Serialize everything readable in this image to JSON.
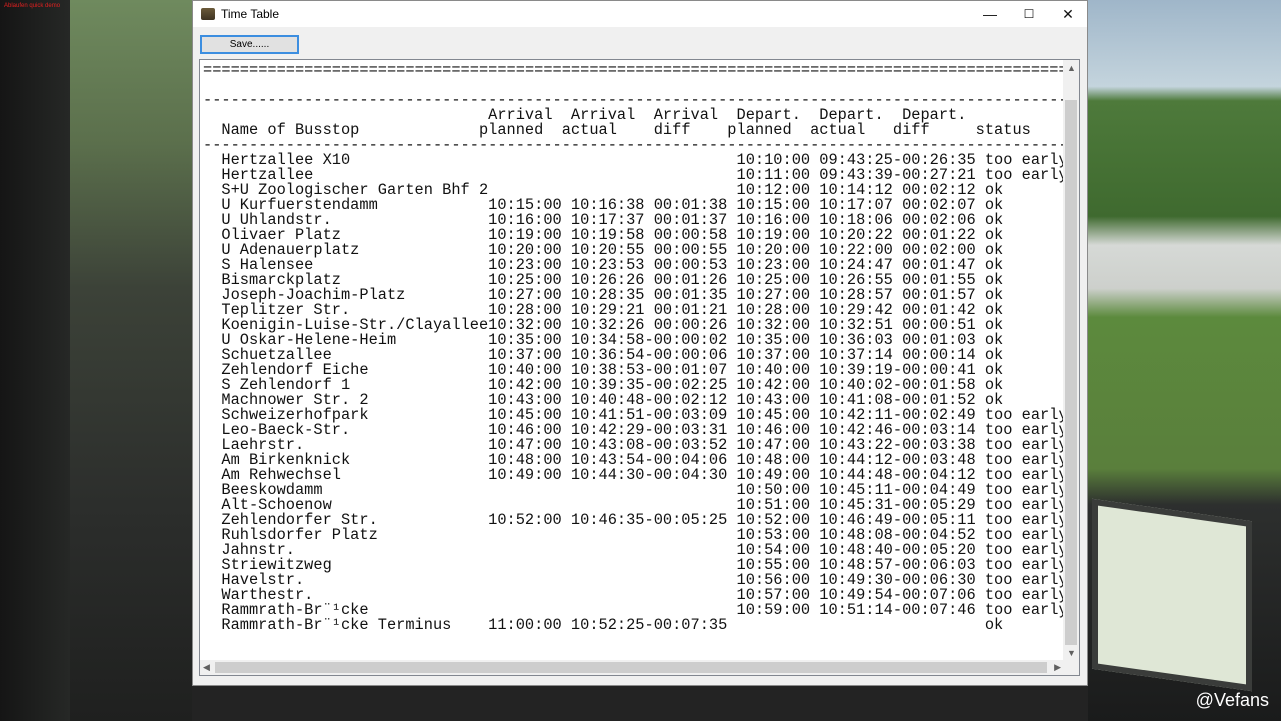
{
  "window": {
    "title": "Time Table",
    "save_label": "Save......",
    "minimize": "—",
    "maximize": "☐",
    "close": "✕"
  },
  "overlay": {
    "watermark": "@Vefans",
    "corner_text": "Ablaufen quick demo"
  },
  "separators": {
    "double": "==========================================================================================================",
    "single": "----------------------------------------------------------------------------------------------------------"
  },
  "header": {
    "name": "Name of Busstop",
    "arr_planned": [
      "Arrival",
      "planned"
    ],
    "arr_actual": [
      "Arrival",
      "actual"
    ],
    "arr_diff": [
      "Arrival",
      "diff"
    ],
    "dep_planned": [
      "Depart.",
      "planned"
    ],
    "dep_actual": [
      "Depart.",
      "actual"
    ],
    "dep_diff": [
      "Depart.",
      "diff"
    ],
    "status": "status"
  },
  "rows": [
    [
      "Hertzallee X10",
      "",
      "",
      "",
      "10:10:00",
      "09:43:25",
      "-00:26:35",
      "too early"
    ],
    [
      "Hertzallee",
      "",
      "",
      "",
      "10:11:00",
      "09:43:39",
      "-00:27:21",
      "too early"
    ],
    [
      "S+U Zoologischer Garten Bhf 2",
      "",
      "",
      "",
      "10:12:00",
      "10:14:12",
      "00:02:12",
      "ok"
    ],
    [
      "U Kurfuerstendamm",
      "10:15:00",
      "10:16:38",
      "00:01:38",
      "10:15:00",
      "10:17:07",
      "00:02:07",
      "ok"
    ],
    [
      "U Uhlandstr.",
      "10:16:00",
      "10:17:37",
      "00:01:37",
      "10:16:00",
      "10:18:06",
      "00:02:06",
      "ok"
    ],
    [
      "Olivaer Platz",
      "10:19:00",
      "10:19:58",
      "00:00:58",
      "10:19:00",
      "10:20:22",
      "00:01:22",
      "ok"
    ],
    [
      "U Adenauerplatz",
      "10:20:00",
      "10:20:55",
      "00:00:55",
      "10:20:00",
      "10:22:00",
      "00:02:00",
      "ok"
    ],
    [
      "S Halensee",
      "10:23:00",
      "10:23:53",
      "00:00:53",
      "10:23:00",
      "10:24:47",
      "00:01:47",
      "ok"
    ],
    [
      "Bismarckplatz",
      "10:25:00",
      "10:26:26",
      "00:01:26",
      "10:25:00",
      "10:26:55",
      "00:01:55",
      "ok"
    ],
    [
      "Joseph-Joachim-Platz",
      "10:27:00",
      "10:28:35",
      "00:01:35",
      "10:27:00",
      "10:28:57",
      "00:01:57",
      "ok"
    ],
    [
      "Teplitzer Str.",
      "10:28:00",
      "10:29:21",
      "00:01:21",
      "10:28:00",
      "10:29:42",
      "00:01:42",
      "ok"
    ],
    [
      "Koenigin-Luise-Str./Clayallee",
      "10:32:00",
      "10:32:26",
      "00:00:26",
      "10:32:00",
      "10:32:51",
      "00:00:51",
      "ok"
    ],
    [
      "U Oskar-Helene-Heim",
      "10:35:00",
      "10:34:58",
      "-00:00:02",
      "10:35:00",
      "10:36:03",
      "00:01:03",
      "ok"
    ],
    [
      "Schuetzallee",
      "10:37:00",
      "10:36:54",
      "-00:00:06",
      "10:37:00",
      "10:37:14",
      "00:00:14",
      "ok"
    ],
    [
      "Zehlendorf Eiche",
      "10:40:00",
      "10:38:53",
      "-00:01:07",
      "10:40:00",
      "10:39:19",
      "-00:00:41",
      "ok"
    ],
    [
      "S Zehlendorf 1",
      "10:42:00",
      "10:39:35",
      "-00:02:25",
      "10:42:00",
      "10:40:02",
      "-00:01:58",
      "ok"
    ],
    [
      "Machnower Str. 2",
      "10:43:00",
      "10:40:48",
      "-00:02:12",
      "10:43:00",
      "10:41:08",
      "-00:01:52",
      "ok"
    ],
    [
      "Schweizerhofpark",
      "10:45:00",
      "10:41:51",
      "-00:03:09",
      "10:45:00",
      "10:42:11",
      "-00:02:49",
      "too early"
    ],
    [
      "Leo-Baeck-Str.",
      "10:46:00",
      "10:42:29",
      "-00:03:31",
      "10:46:00",
      "10:42:46",
      "-00:03:14",
      "too early"
    ],
    [
      "Laehrstr.",
      "10:47:00",
      "10:43:08",
      "-00:03:52",
      "10:47:00",
      "10:43:22",
      "-00:03:38",
      "too early"
    ],
    [
      "Am Birkenknick",
      "10:48:00",
      "10:43:54",
      "-00:04:06",
      "10:48:00",
      "10:44:12",
      "-00:03:48",
      "too early"
    ],
    [
      "Am Rehwechsel",
      "10:49:00",
      "10:44:30",
      "-00:04:30",
      "10:49:00",
      "10:44:48",
      "-00:04:12",
      "too early"
    ],
    [
      "Beeskowdamm",
      "",
      "",
      "",
      "10:50:00",
      "10:45:11",
      "-00:04:49",
      "too early"
    ],
    [
      "Alt-Schoenow",
      "",
      "",
      "",
      "10:51:00",
      "10:45:31",
      "-00:05:29",
      "too early"
    ],
    [
      "Zehlendorfer Str.",
      "10:52:00",
      "10:46:35",
      "-00:05:25",
      "10:52:00",
      "10:46:49",
      "-00:05:11",
      "too early"
    ],
    [
      "Ruhlsdorfer Platz",
      "",
      "",
      "",
      "10:53:00",
      "10:48:08",
      "-00:04:52",
      "too early"
    ],
    [
      "Jahnstr.",
      "",
      "",
      "",
      "10:54:00",
      "10:48:40",
      "-00:05:20",
      "too early"
    ],
    [
      "Striewitzweg",
      "",
      "",
      "",
      "10:55:00",
      "10:48:57",
      "-00:06:03",
      "too early"
    ],
    [
      "Havelstr.",
      "",
      "",
      "",
      "10:56:00",
      "10:49:30",
      "-00:06:30",
      "too early"
    ],
    [
      "Warthestr.",
      "",
      "",
      "",
      "10:57:00",
      "10:49:54",
      "-00:07:06",
      "too early"
    ],
    [
      "Rammrath-Br¨¹cke",
      "",
      "",
      "",
      "10:59:00",
      "10:51:14",
      "-00:07:46",
      "too early"
    ],
    [
      "Rammrath-Br¨¹cke Terminus",
      "11:00:00",
      "10:52:25",
      "-00:07:35",
      "",
      "",
      "",
      "ok"
    ]
  ]
}
